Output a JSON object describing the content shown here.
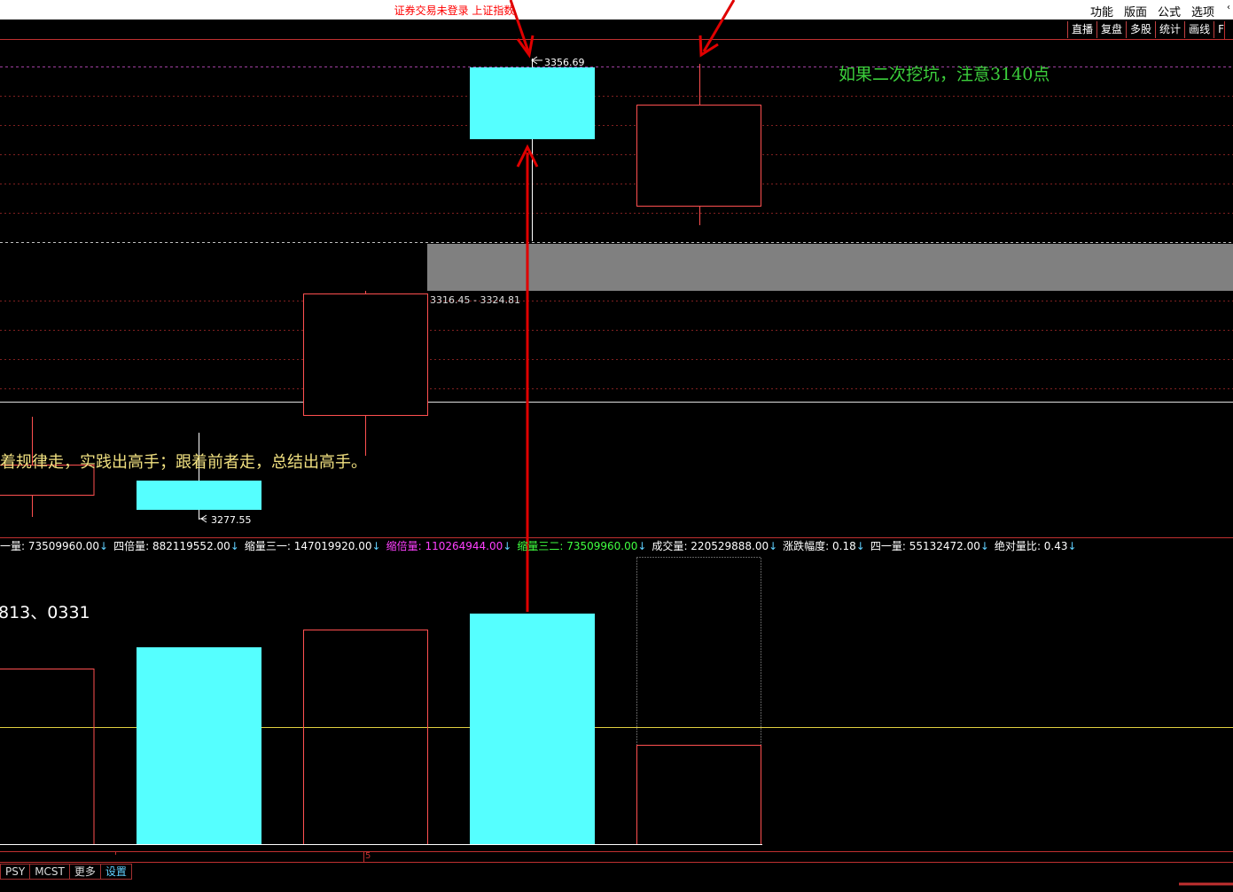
{
  "titlebar": {
    "status_text": "证券交易未登录  上证指数",
    "menus": [
      "功能",
      "版面",
      "公式",
      "选项"
    ]
  },
  "toolbar": {
    "buttons": [
      "直播",
      "复盘",
      "多股",
      "统计",
      "画线",
      "F"
    ]
  },
  "price_chart": {
    "high_label": "3356.69",
    "low_label": "3277.55",
    "zone_label": "3316.45 - 3324.81",
    "annotation_green": "如果二次挖坑，注意3140点",
    "annotation_yellow": "跟着规律走，实践出高手；跟着前者走，总结出高手。"
  },
  "volume_panel": {
    "readouts": [
      {
        "name": "一量",
        "value": "73509960.00",
        "color": "#ffffff"
      },
      {
        "name": "四倍量",
        "value": "882119552.00",
        "color": "#ffffff"
      },
      {
        "name": "缩量三一",
        "value": "147019920.00",
        "color": "#ffffff"
      },
      {
        "name": "缩倍量",
        "value": "110264944.00",
        "color": "#ff40ff"
      },
      {
        "name": "缩量三二",
        "value": "73509960.00",
        "color": "#40ff40"
      },
      {
        "name": "成交量",
        "value": "220529888.00",
        "color": "#ffffff"
      },
      {
        "name": "涨跌幅度",
        "value": "0.18",
        "color": "#ffffff"
      },
      {
        "name": "四一量",
        "value": "55132472.00",
        "color": "#ffffff"
      },
      {
        "name": "绝对量比",
        "value": "0.43",
        "color": "#ffffff"
      }
    ],
    "annotation": "813、0331",
    "axis_label": "5"
  },
  "bottom_tabs": [
    "PSY",
    "MCST",
    "更多",
    "设置"
  ],
  "colors": {
    "cyan": "#55ffff",
    "red_line": "#ff5050",
    "arrow_red": "#e00000",
    "green_text": "#3ccf3c",
    "yellow_text": "#f0e080",
    "gray_zone": "#808080"
  }
}
